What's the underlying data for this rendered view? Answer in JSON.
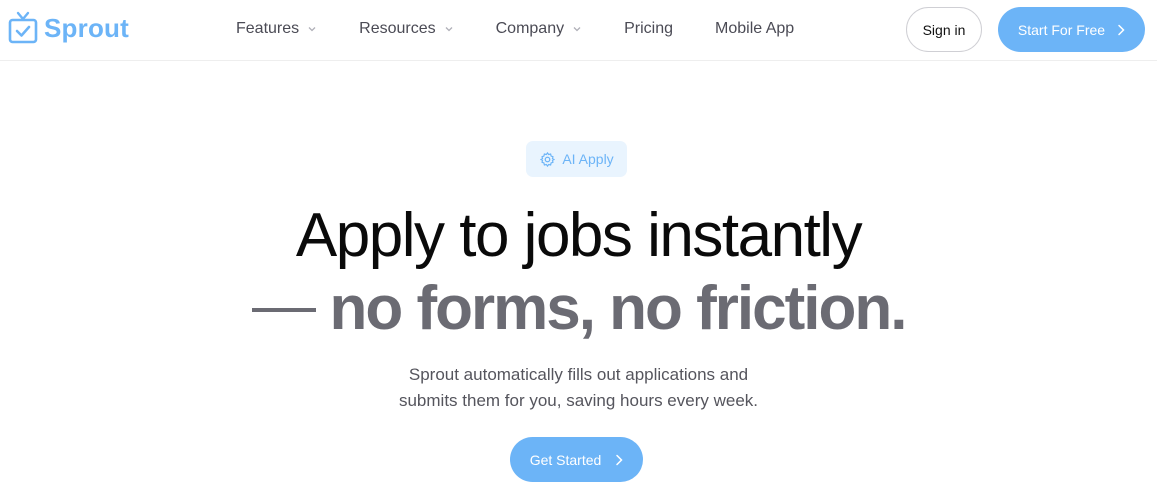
{
  "brand": {
    "name": "Sprout",
    "logo_icon": "tv-check-icon",
    "color": "#6cb4f7"
  },
  "nav": {
    "items": [
      {
        "label": "Features",
        "has_dropdown": true
      },
      {
        "label": "Resources",
        "has_dropdown": true
      },
      {
        "label": "Company",
        "has_dropdown": true
      },
      {
        "label": "Pricing",
        "has_dropdown": false
      },
      {
        "label": "Mobile App",
        "has_dropdown": false
      }
    ],
    "signin_label": "Sign in",
    "start_label": "Start For Free"
  },
  "hero": {
    "badge_label": "AI Apply",
    "badge_icon": "gear-icon",
    "headline_line1": "Apply to jobs instantly",
    "headline_line2": "no forms, no friction.",
    "subtext_line1": "Sprout automatically fills out applications and",
    "subtext_line2": "submits them for you, saving hours every week.",
    "cta_label": "Get Started"
  },
  "colors": {
    "accent": "#6cb4f7",
    "badge_bg": "#e9f4fe",
    "headline": "#0a0a0a",
    "headline_muted": "#6b6b73"
  }
}
